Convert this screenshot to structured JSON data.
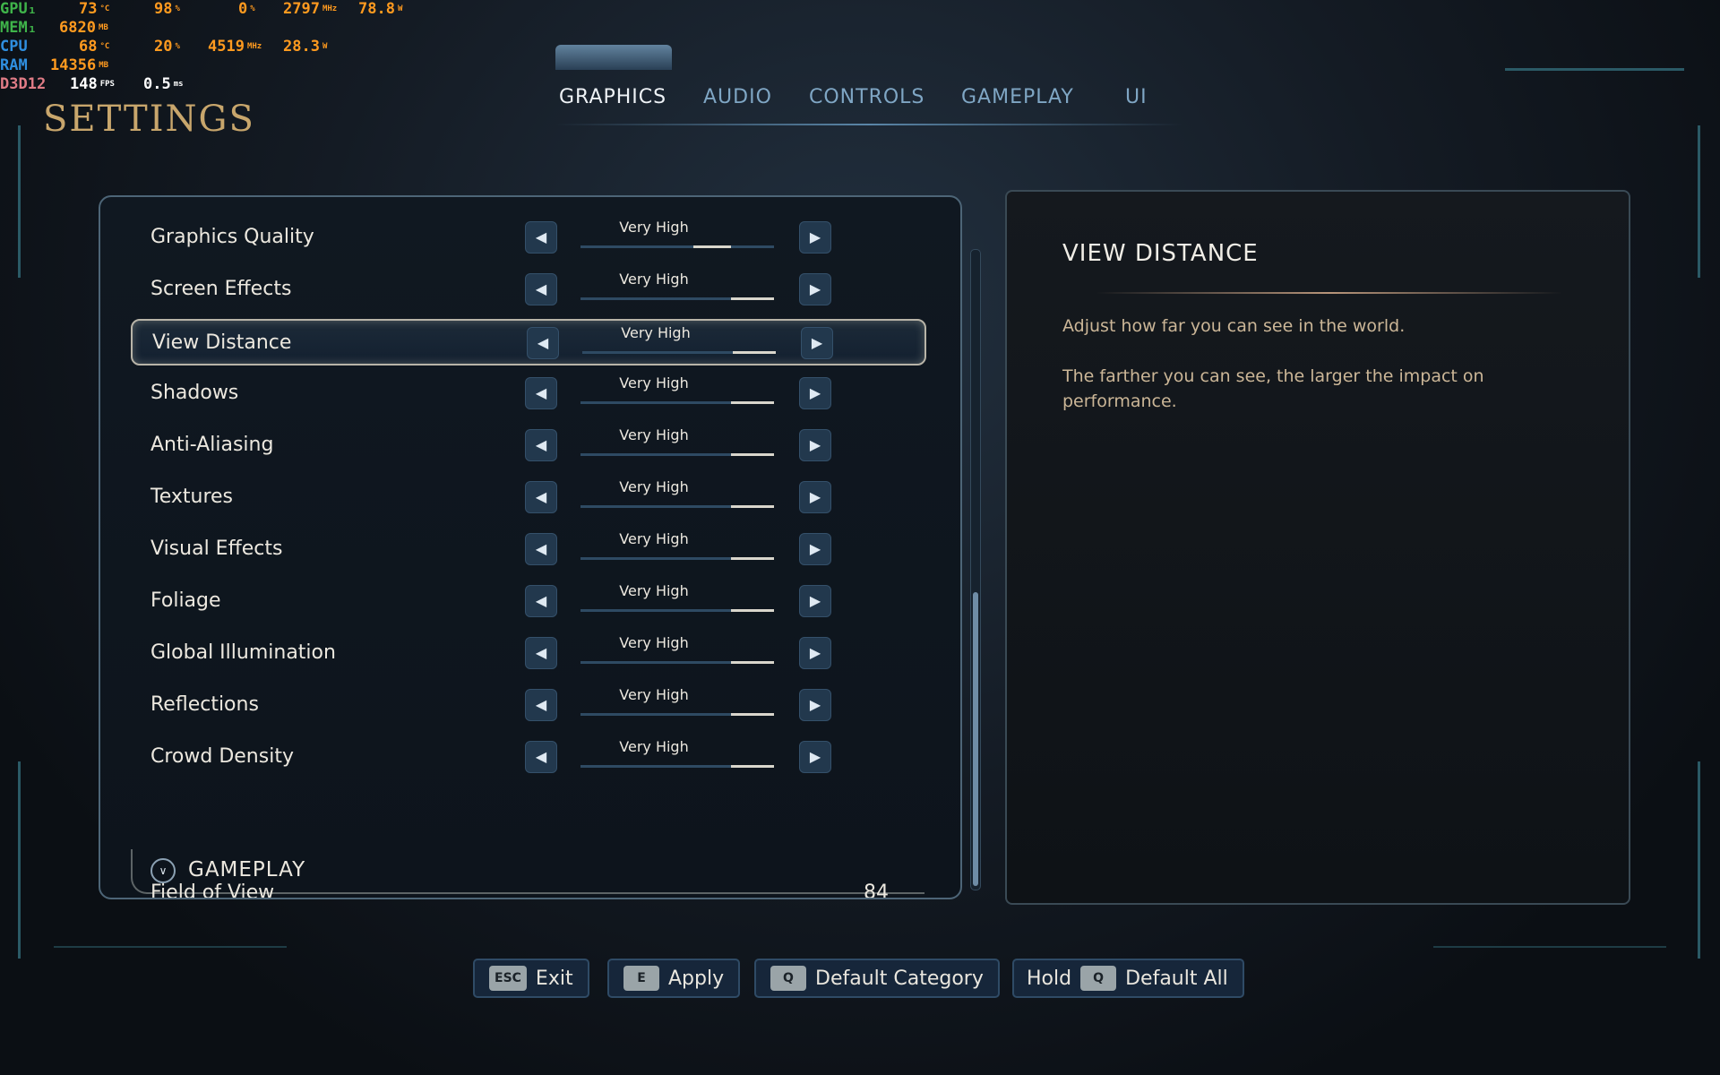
{
  "overlay": {
    "gpu": {
      "label": "GPU₁",
      "temp": "73",
      "temp_unit": "°C",
      "load": "98",
      "load_unit": "%",
      "fan": "0",
      "fan_unit": "%",
      "clock": "2797",
      "clock_unit": "MHz",
      "power": "78.8",
      "power_unit": "W"
    },
    "mem": {
      "label": "MEM₁",
      "value": "6820",
      "unit": "MB"
    },
    "cpu": {
      "label": "CPU",
      "temp": "68",
      "temp_unit": "°C",
      "load": "20",
      "load_unit": "%",
      "clock": "4519",
      "clock_unit": "MHz",
      "power": "28.3",
      "power_unit": "W"
    },
    "ram": {
      "label": "RAM",
      "value": "14356",
      "unit": "MB"
    },
    "api": {
      "label": "D3D12",
      "fps": "148",
      "fps_unit": "FPS",
      "frametime": "0.5",
      "frametime_unit": "ms"
    }
  },
  "page_title": "SETTINGS",
  "tabs": [
    {
      "label": "GRAPHICS",
      "active": true
    },
    {
      "label": "AUDIO",
      "active": false
    },
    {
      "label": "CONTROLS",
      "active": false
    },
    {
      "label": "GAMEPLAY",
      "active": false
    },
    {
      "label": "UI",
      "active": false
    }
  ],
  "settings": [
    {
      "label": "Graphics Quality",
      "value": "Very High",
      "level": 4,
      "of": 5
    },
    {
      "label": "Screen Effects",
      "value": "Very High",
      "level": 5,
      "of": 5
    },
    {
      "label": "View Distance",
      "value": "Very High",
      "level": 5,
      "of": 5,
      "selected": true
    },
    {
      "label": "Shadows",
      "value": "Very High",
      "level": 5,
      "of": 5
    },
    {
      "label": "Anti-Aliasing",
      "value": "Very High",
      "level": 5,
      "of": 5
    },
    {
      "label": "Textures",
      "value": "Very High",
      "level": 5,
      "of": 5
    },
    {
      "label": "Visual Effects",
      "value": "Very High",
      "level": 5,
      "of": 5
    },
    {
      "label": "Foliage",
      "value": "Very High",
      "level": 5,
      "of": 5
    },
    {
      "label": "Global Illumination",
      "value": "Very High",
      "level": 5,
      "of": 5
    },
    {
      "label": "Reflections",
      "value": "Very High",
      "level": 5,
      "of": 5
    },
    {
      "label": "Crowd Density",
      "value": "Very High",
      "level": 5,
      "of": 5
    }
  ],
  "category": {
    "label": "GAMEPLAY"
  },
  "partial_row": {
    "label": "Field of View",
    "value": "84"
  },
  "info": {
    "title": "VIEW DISTANCE",
    "paragraph1": "Adjust how far you can see in the world.",
    "paragraph2": "The farther you can see, the larger the impact on performance."
  },
  "footer": {
    "exit": {
      "key": "ESC",
      "label": "Exit"
    },
    "apply": {
      "key": "E",
      "label": "Apply"
    },
    "default_category": {
      "key": "Q",
      "label": "Default Category"
    },
    "default_all": {
      "prefix": "Hold",
      "key": "Q",
      "label": "Default All"
    }
  },
  "colors": {
    "accent_gold": "#c8a66c",
    "tab_inactive": "#7fa6c4",
    "panel_border": "#4d6577"
  }
}
